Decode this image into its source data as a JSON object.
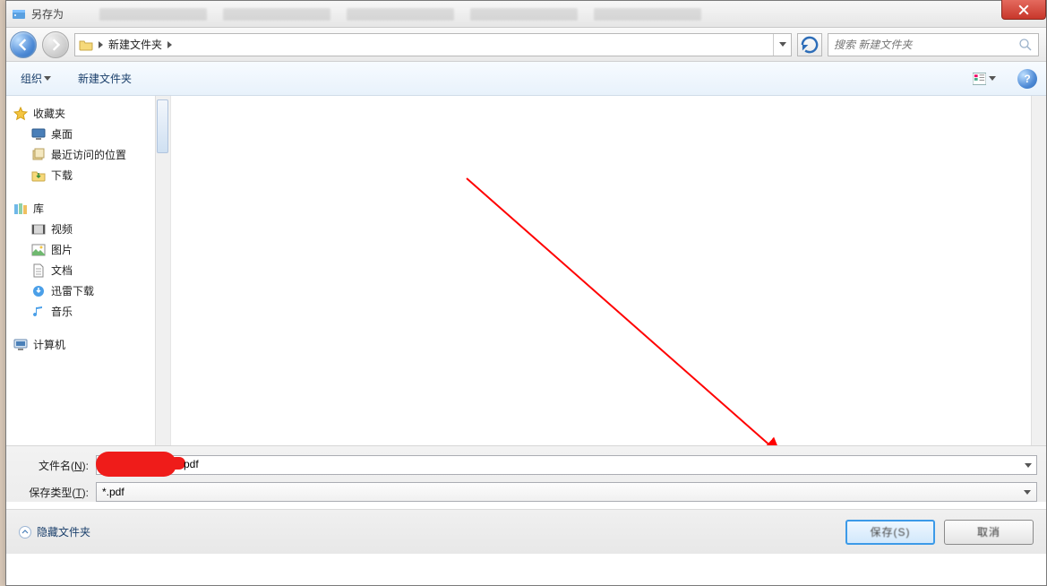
{
  "window": {
    "title": "另存为"
  },
  "nav": {
    "crumbs": [
      "",
      "新建文件夹"
    ],
    "search_placeholder": "搜索 新建文件夹"
  },
  "toolbar": {
    "organize": "组织",
    "new_folder": "新建文件夹"
  },
  "sidebar": {
    "favorites": {
      "label": "收藏夹",
      "items": [
        {
          "icon": "desktop",
          "label": "桌面"
        },
        {
          "icon": "recent",
          "label": "最近访问的位置"
        },
        {
          "icon": "downloads",
          "label": "下载"
        }
      ]
    },
    "libraries": {
      "label": "库",
      "items": [
        {
          "icon": "video",
          "label": "视频"
        },
        {
          "icon": "picture",
          "label": "图片"
        },
        {
          "icon": "document",
          "label": "文档"
        },
        {
          "icon": "xunlei",
          "label": "迅雷下载"
        },
        {
          "icon": "music",
          "label": "音乐"
        }
      ]
    },
    "computer": {
      "label": "计算机"
    }
  },
  "form": {
    "filename_label": "文件名(N):",
    "filename_ext_tail": "pdf",
    "type_label": "保存类型(T):",
    "type_value": "*.pdf"
  },
  "footer": {
    "hide_folders": "隐藏文件夹",
    "save": "保存(S)",
    "cancel": "取消"
  }
}
